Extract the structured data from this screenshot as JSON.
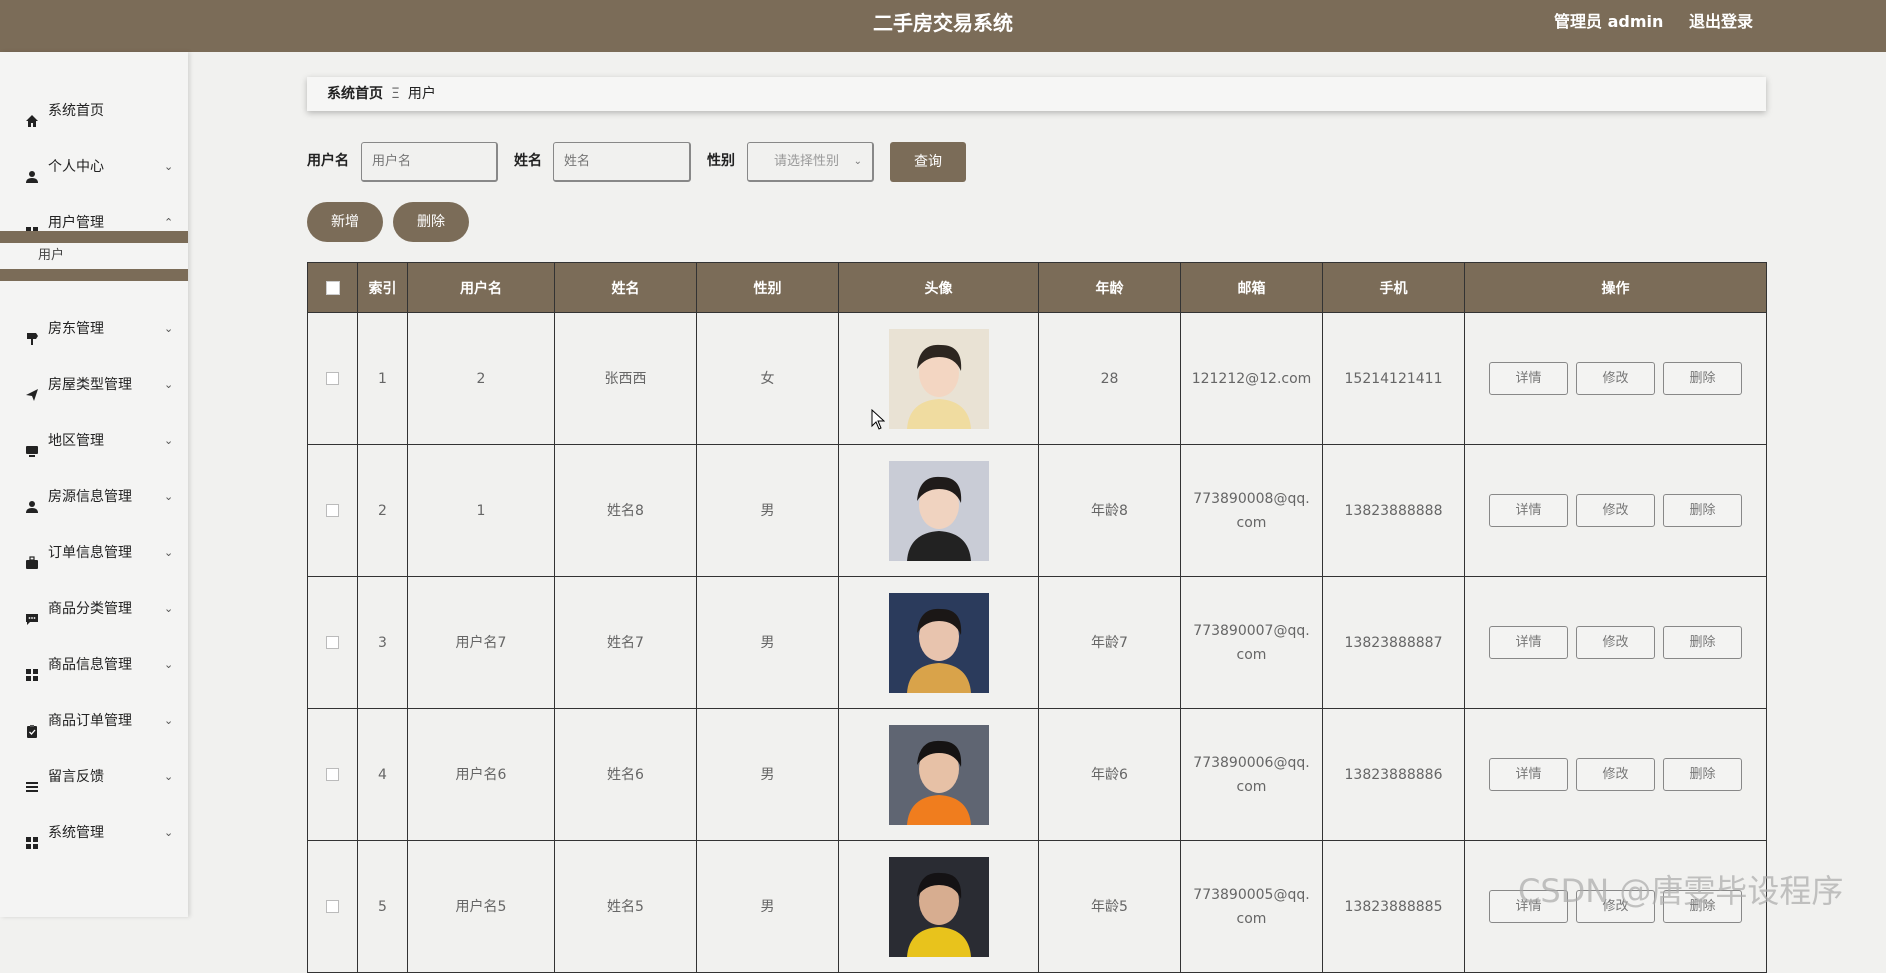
{
  "header": {
    "title": "二手房交易系统",
    "admin_label": "管理员 admin",
    "logout_label": "退出登录"
  },
  "sidebar": {
    "items": [
      {
        "label": "系统首页",
        "icon": "home-icon",
        "chevron": ""
      },
      {
        "label": "个人中心",
        "icon": "person-icon",
        "chevron": "⌄"
      },
      {
        "label": "用户管理",
        "icon": "grid-icon",
        "chevron": "⌃"
      },
      {
        "label": "房东管理",
        "icon": "signpost-icon",
        "chevron": "⌄"
      },
      {
        "label": "房屋类型管理",
        "icon": "paper-plane-icon",
        "chevron": "⌄"
      },
      {
        "label": "地区管理",
        "icon": "monitor-icon",
        "chevron": "⌄"
      },
      {
        "label": "房源信息管理",
        "icon": "person-icon",
        "chevron": "⌄"
      },
      {
        "label": "订单信息管理",
        "icon": "briefcase-icon",
        "chevron": "⌄"
      },
      {
        "label": "商品分类管理",
        "icon": "chat-icon",
        "chevron": "⌄"
      },
      {
        "label": "商品信息管理",
        "icon": "grid-icon",
        "chevron": "⌄"
      },
      {
        "label": "商品订单管理",
        "icon": "clipboard-icon",
        "chevron": "⌄"
      },
      {
        "label": "留言反馈",
        "icon": "list-icon",
        "chevron": "⌄"
      },
      {
        "label": "系统管理",
        "icon": "grid-icon",
        "chevron": "⌄"
      }
    ],
    "submenu": {
      "label": "用户"
    }
  },
  "breadcrumb": {
    "home": "系统首页",
    "separator": "Ξ",
    "current": "用户"
  },
  "filters": {
    "username_label": "用户名",
    "username_placeholder": "用户名",
    "name_label": "姓名",
    "name_placeholder": "姓名",
    "gender_label": "性别",
    "gender_placeholder": "请选择性别",
    "query_button": "查询"
  },
  "actions": {
    "add_button": "新增",
    "delete_button": "删除"
  },
  "table": {
    "headers": [
      "索引",
      "用户名",
      "姓名",
      "性别",
      "头像",
      "年龄",
      "邮箱",
      "手机",
      "操作"
    ],
    "op_labels": {
      "detail": "详情",
      "edit": "修改",
      "delete": "删除"
    },
    "rows": [
      {
        "index": "1",
        "username": "2",
        "name": "张西西",
        "gender": "女",
        "age": "28",
        "email": "121212@12.com",
        "phone": "15214121411"
      },
      {
        "index": "2",
        "username": "1",
        "name": "姓名8",
        "gender": "男",
        "age": "年龄8",
        "email": "773890008@qq.com",
        "phone": "13823888888"
      },
      {
        "index": "3",
        "username": "用户名7",
        "name": "姓名7",
        "gender": "男",
        "age": "年龄7",
        "email": "773890007@qq.com",
        "phone": "13823888887"
      },
      {
        "index": "4",
        "username": "用户名6",
        "name": "姓名6",
        "gender": "男",
        "age": "年龄6",
        "email": "773890006@qq.com",
        "phone": "13823888886"
      },
      {
        "index": "5",
        "username": "用户名5",
        "name": "姓名5",
        "gender": "男",
        "age": "年龄5",
        "email": "773890005@qq.com",
        "phone": "13823888885"
      }
    ]
  },
  "watermark": "CSDN @唐雯毕设程序",
  "colors": {
    "brand": "#7b6c58",
    "background": "#f1f1ef"
  }
}
